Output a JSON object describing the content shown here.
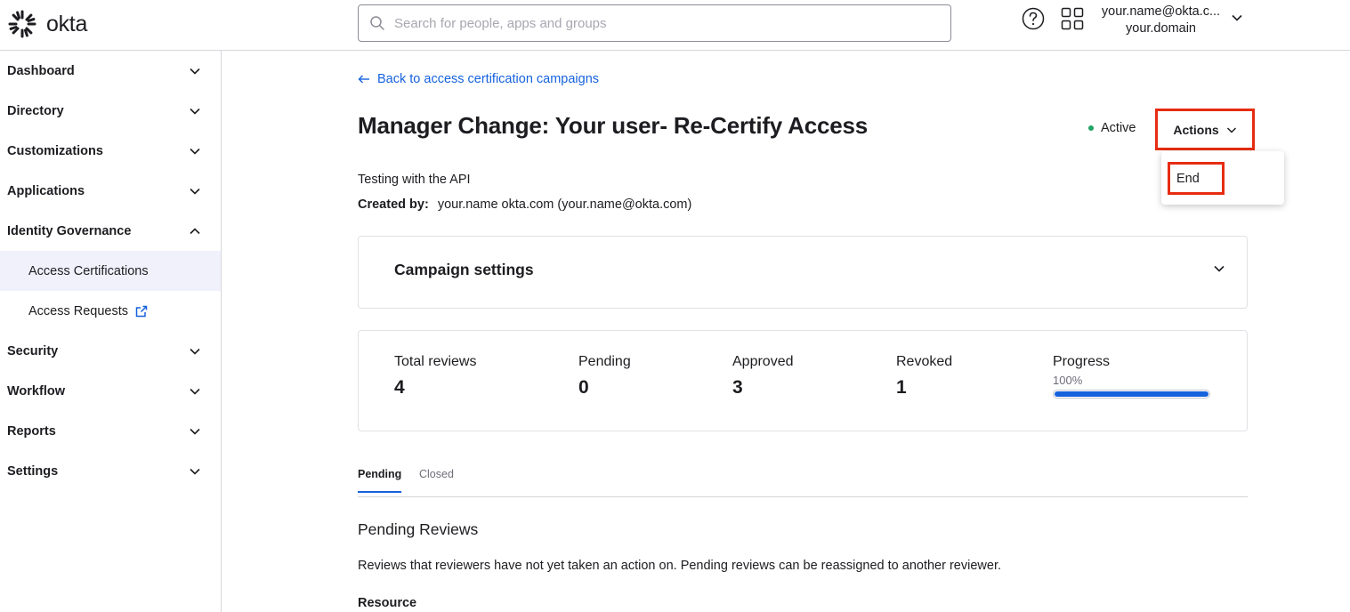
{
  "brand": {
    "name": "okta",
    "accent": "#1662dd",
    "highlight": "#e62c10",
    "active_status_color": "#1fa465"
  },
  "header": {
    "search_placeholder": "Search for people, apps and groups",
    "help_icon": "help-circle-icon",
    "apps_icon": "grid-apps-icon",
    "user_email": "your.name@okta.c...",
    "user_domain": "your.domain"
  },
  "sidebar": {
    "items": [
      {
        "label": "Dashboard"
      },
      {
        "label": "Directory"
      },
      {
        "label": "Customizations"
      },
      {
        "label": "Applications"
      },
      {
        "label": "Identity Governance"
      },
      {
        "label": "Access Certifications"
      },
      {
        "label": "Access Requests"
      },
      {
        "label": "Security"
      },
      {
        "label": "Workflow"
      },
      {
        "label": "Reports"
      },
      {
        "label": "Settings"
      }
    ]
  },
  "main": {
    "back_link": "Back to access certification campaigns",
    "title": "Manager Change: Your user- Re-Certify Access",
    "status": "Active",
    "actions_label": "Actions",
    "actions_menu": [
      "End"
    ],
    "description": "Testing with the API",
    "created_by_label": "Created by:",
    "created_by_value": "your.name okta.com (your.name@okta.com)",
    "settings_title": "Campaign settings",
    "stats": {
      "total_label": "Total reviews",
      "total_value": "4",
      "pending_label": "Pending",
      "pending_value": "0",
      "approved_label": "Approved",
      "approved_value": "3",
      "revoked_label": "Revoked",
      "revoked_value": "1",
      "progress_label": "Progress",
      "progress_text": "100%",
      "progress_fraction": 1.0
    },
    "tabs": [
      {
        "label": "Pending"
      },
      {
        "label": "Closed"
      }
    ],
    "section_title": "Pending Reviews",
    "section_desc": "Reviews that reviewers have not yet taken an action on. Pending reviews can be reassigned to another reviewer.",
    "resource_label": "Resource"
  }
}
